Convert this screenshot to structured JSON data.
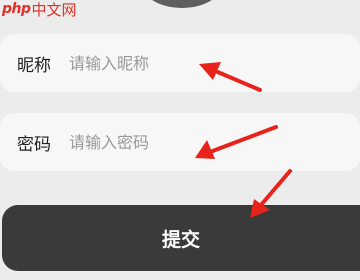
{
  "watermark": {
    "logo": "php",
    "text": "中文网"
  },
  "form": {
    "nickname": {
      "label": "昵称",
      "placeholder": "请输入昵称",
      "value": ""
    },
    "password": {
      "label": "密码",
      "placeholder": "请输入密码",
      "value": ""
    },
    "submit_label": "提交"
  },
  "colors": {
    "page_background": "#ececec",
    "field_background": "#f7f7f7",
    "button_background": "#3a3a3a",
    "button_text": "#ffffff",
    "annotation_arrow": "#e8231c",
    "watermark": "#e0322b"
  },
  "icons": {
    "annotation": "red-arrow-icon"
  }
}
